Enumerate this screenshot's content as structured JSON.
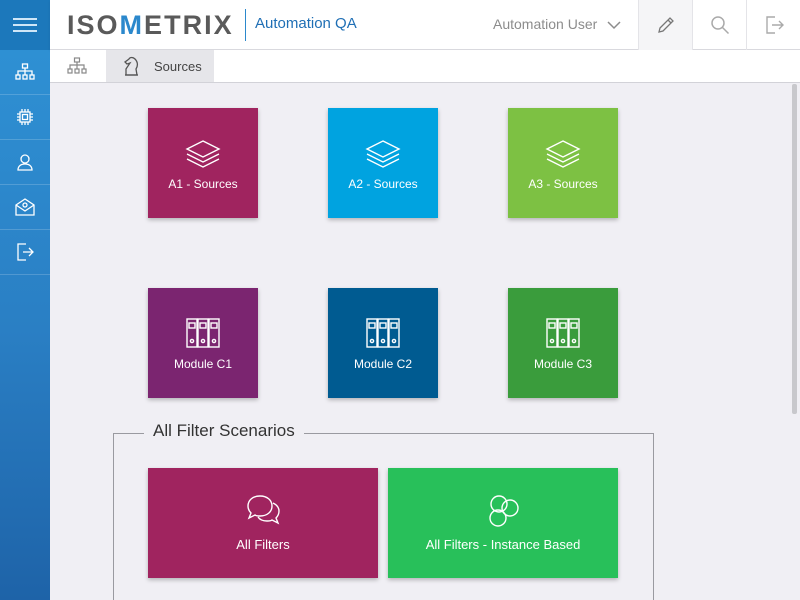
{
  "header": {
    "logo": "ISOMETRIX",
    "project": "Automation QA",
    "user": "Automation User"
  },
  "breadcrumb": {
    "current": "Sources"
  },
  "tiles": [
    {
      "label": "A1 - Sources",
      "color": "#a0245f",
      "icon": "layers-icon"
    },
    {
      "label": "A2 - Sources",
      "color": "#00a3e0",
      "icon": "layers-icon"
    },
    {
      "label": "A3 - Sources",
      "color": "#7dc143",
      "icon": "layers-icon"
    },
    {
      "label": "Module C1",
      "color": "#7b2570",
      "icon": "binders-icon"
    },
    {
      "label": "Module C2",
      "color": "#005b91",
      "icon": "binders-icon"
    },
    {
      "label": "Module C3",
      "color": "#3a9c3c",
      "icon": "binders-icon"
    }
  ],
  "filter_group": {
    "title": "All Filter Scenarios",
    "tiles": [
      {
        "label": "All Filters",
        "color": "#a0245f",
        "icon": "speech-bubbles-icon"
      },
      {
        "label": "All Filters - Instance Based",
        "color": "#28c05a",
        "icon": "speech-bubbles-icon"
      }
    ]
  },
  "sidebar": {
    "items": [
      "menu-icon",
      "org-chart-icon",
      "chip-icon",
      "user-icon",
      "mail-icon",
      "logout-icon"
    ]
  }
}
